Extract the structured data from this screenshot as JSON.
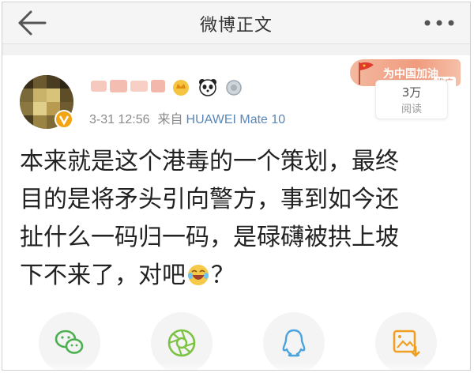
{
  "nav": {
    "title": "微博正文",
    "back_icon": "back-arrow-icon",
    "more_icon": "more-dots-icon"
  },
  "post": {
    "meta_time": "3-31 12:56",
    "meta_source_prefix": "来自",
    "meta_source": "HUAWEI Mate 10",
    "text_lines": [
      "本来就是这个港毒的一个策划，最终",
      "目的是将矛头引向警方，事到如今还",
      "扯什么一码归一码，是碌礴被拱上坡",
      "下不来了，对吧"
    ],
    "text_tail": "？"
  },
  "promo": {
    "banner_text": "为中国加油",
    "tag": "推广",
    "read_count": "3万",
    "read_label": "阅读"
  },
  "share": {
    "items": [
      "wechat-icon",
      "moments-icon",
      "qq-icon",
      "save-image-icon"
    ]
  },
  "colors": {
    "nav_bg": "#f5f5f5",
    "text": "#222222",
    "meta": "#8a8a8a",
    "source": "#5a86b8",
    "icon_green": "#4caf50",
    "icon_qq": "#4aa3df",
    "icon_orange": "#f0a020"
  }
}
